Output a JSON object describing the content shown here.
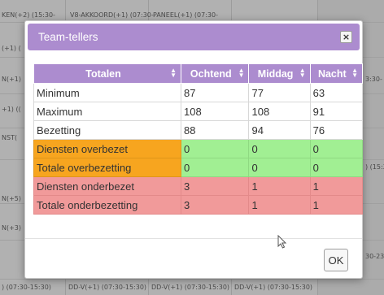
{
  "background": {
    "top_row": [
      "KEN(+2) (15:30-",
      "V8-AKKOORD(+1) (07:30-",
      "PANEEL(+1) (07:30-"
    ],
    "left_col": [
      "(+1) (",
      "N(+1)",
      "+1) ((",
      "NST(",
      "N(+5)",
      "N(+3)"
    ],
    "right_col": [
      "3:30-",
      ") (15:3",
      "30-23"
    ],
    "bottom_row": [
      ") (07:30-15:30)",
      "DD-V(+1) (07:30-15:30)",
      "DD-V(+1) (07:30-15:30)",
      "DD-V(+1) (07:30-15:30)"
    ]
  },
  "dialog": {
    "title": "Team-tellers",
    "close_icon": "×",
    "ok_label": "OK"
  },
  "table": {
    "headers": [
      "Totalen",
      "Ochtend",
      "Middag",
      "Nacht"
    ],
    "rows": [
      {
        "label": "Minimum",
        "values": [
          "87",
          "77",
          "63"
        ],
        "style": "plain"
      },
      {
        "label": "Maximum",
        "values": [
          "108",
          "108",
          "91"
        ],
        "style": "plain"
      },
      {
        "label": "Bezetting",
        "values": [
          "88",
          "94",
          "76"
        ],
        "style": "plain"
      },
      {
        "label": "Diensten overbezet",
        "values": [
          "0",
          "0",
          "0"
        ],
        "style": "orange"
      },
      {
        "label": "Totale overbezetting",
        "values": [
          "0",
          "0",
          "0"
        ],
        "style": "orange"
      },
      {
        "label": "Diensten onderbezet",
        "values": [
          "3",
          "1",
          "1"
        ],
        "style": "red"
      },
      {
        "label": "Totale onderbezetting",
        "values": [
          "3",
          "1",
          "1"
        ],
        "style": "red"
      }
    ]
  },
  "colors": {
    "purple": "#ac8ccf",
    "orange": "#f7a51f",
    "green": "#a1ef93",
    "red": "#f19a9a"
  }
}
